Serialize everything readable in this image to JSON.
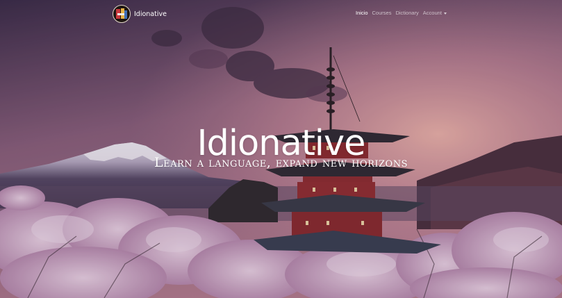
{
  "navbar": {
    "brand_name": "Idionative",
    "links": [
      {
        "label": "Inicio",
        "active": true
      },
      {
        "label": "Courses",
        "active": false
      },
      {
        "label": "Dictionary",
        "active": false
      },
      {
        "label": "Account",
        "active": false,
        "dropdown": true
      }
    ]
  },
  "hero": {
    "title": "Idionative",
    "subtitle": "Learn a language, expand new horizons",
    "background_image": "mount-fuji-pagoda-cherry-blossoms"
  },
  "colors": {
    "sky_top": "#3d2d4a",
    "sky_glow": "#e9a9a6",
    "blossom": "#d7b4d0",
    "pagoda_red": "#8c2a2e",
    "text": "#ffffff"
  }
}
